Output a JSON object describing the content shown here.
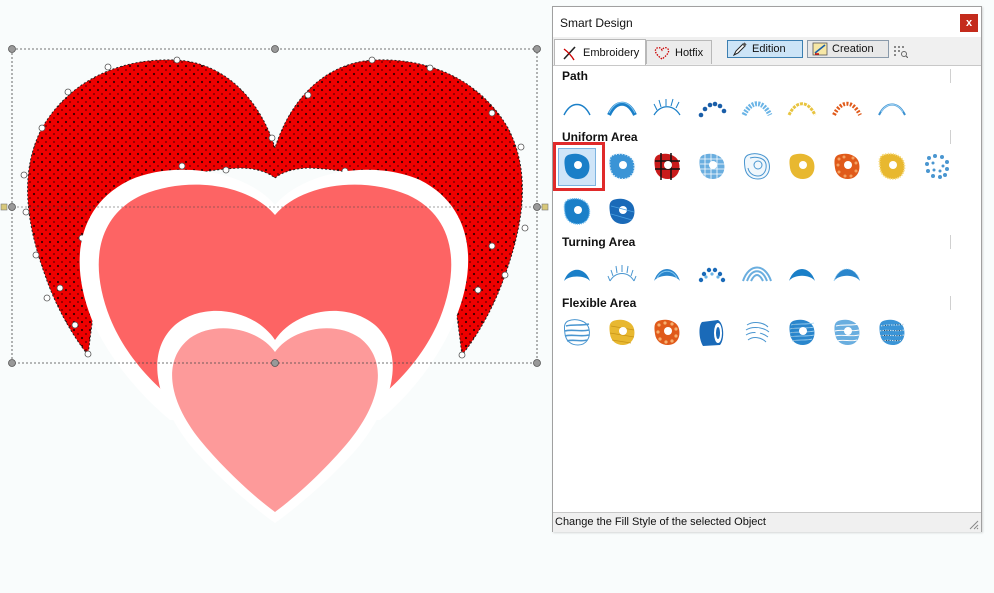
{
  "panel": {
    "title": "Smart Design",
    "close_label": "x",
    "tabs": [
      {
        "label": "Embroidery",
        "active": true,
        "icon": "needle-icon"
      },
      {
        "label": "Hotfix",
        "active": false,
        "icon": "hotfix-heart-icon"
      }
    ],
    "tool_buttons": [
      {
        "label": "Edition",
        "active": true,
        "icon": "edit-pen-icon"
      },
      {
        "label": "Creation",
        "active": false,
        "icon": "creation-tool-icon"
      }
    ],
    "sections": [
      {
        "title": "Path"
      },
      {
        "title": "Uniform Area"
      },
      {
        "title": "Turning Area"
      },
      {
        "title": "Flexible Area"
      }
    ],
    "selected_style": "Uniform Area 1",
    "status": "Change the Fill Style of the selected Object"
  },
  "colors": {
    "accent_blue": "#1a7fc8",
    "selection_red": "#e02a2a",
    "heart_dark": "#ee0000",
    "heart_medium": "#fd6464",
    "heart_light": "#fd9a9a"
  }
}
